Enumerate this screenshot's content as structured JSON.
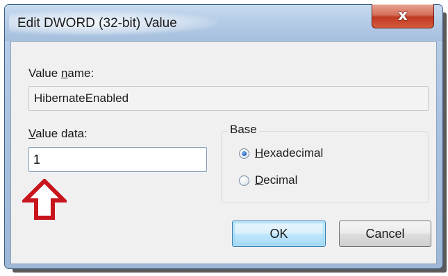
{
  "window": {
    "title": "Edit DWORD (32-bit) Value",
    "close_label": "x"
  },
  "value_name": {
    "label_pre": "Value ",
    "label_accel": "n",
    "label_post": "ame:",
    "value": "HibernateEnabled"
  },
  "value_data": {
    "label_accel": "V",
    "label_post": "alue data:",
    "value": "1"
  },
  "base": {
    "legend": "Base",
    "options": [
      {
        "accel": "H",
        "rest": "exadecimal",
        "checked": true
      },
      {
        "accel": "D",
        "rest": "ecimal",
        "checked": false
      }
    ]
  },
  "buttons": {
    "ok": "OK",
    "cancel": "Cancel"
  },
  "colors": {
    "annotation_arrow": "#c8141c",
    "titlebar": "#b4cbe6",
    "close_button": "#c03a22"
  }
}
